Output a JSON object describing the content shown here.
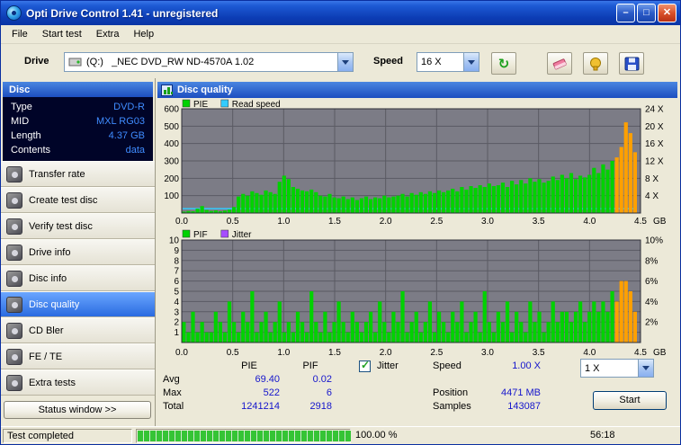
{
  "window": {
    "title": "Opti Drive Control 1.41 - unregistered"
  },
  "menu": {
    "items": [
      {
        "label": "File"
      },
      {
        "label": "Start test"
      },
      {
        "label": "Extra"
      },
      {
        "label": "Help"
      }
    ]
  },
  "toolbar": {
    "drive_label": "Drive",
    "drive_value": "(Q:)   _NEC DVD_RW ND-4570A 1.02",
    "speed_label": "Speed",
    "speed_value": "16 X"
  },
  "sidebar": {
    "header": "Disc",
    "info": [
      {
        "label": "Type",
        "value": "DVD-R"
      },
      {
        "label": "MID",
        "value": "MXL RG03"
      },
      {
        "label": "Length",
        "value": "4.37 GB"
      },
      {
        "label": "Contents",
        "value": "data"
      }
    ],
    "nav": [
      {
        "label": "Transfer rate",
        "selected": false
      },
      {
        "label": "Create test disc",
        "selected": false
      },
      {
        "label": "Verify test disc",
        "selected": false
      },
      {
        "label": "Drive info",
        "selected": false
      },
      {
        "label": "Disc info",
        "selected": false
      },
      {
        "label": "Disc quality",
        "selected": true
      },
      {
        "label": "CD Bler",
        "selected": false
      },
      {
        "label": "FE / TE",
        "selected": false
      },
      {
        "label": "Extra tests",
        "selected": false
      }
    ],
    "status_window_button": "Status window >>"
  },
  "main": {
    "header": "Disc quality",
    "stats": {
      "col_pie": "PIE",
      "col_pif": "PIF",
      "rows": [
        {
          "label": "Avg",
          "pie": "69.40",
          "pif": "0.02"
        },
        {
          "label": "Max",
          "pie": "522",
          "pif": "6"
        },
        {
          "label": "Total",
          "pie": "1241214",
          "pif": "2918"
        }
      ],
      "jitter_label": "Jitter",
      "jitter_checked": true,
      "speed_label": "Speed",
      "speed_value": "1.00 X",
      "position_label": "Position",
      "position_value": "4471 MB",
      "samples_label": "Samples",
      "samples_value": "143087",
      "speed_select": "1 X",
      "start_button": "Start"
    }
  },
  "statusbar": {
    "status": "Test completed",
    "progress_percent": 100,
    "percent_text": "100.00 %",
    "time": "56:18"
  },
  "chart_data": [
    {
      "type": "bar",
      "title": "PIE and read speed vs disc position",
      "legend": [
        {
          "label": "PIE",
          "color": "#00d200"
        },
        {
          "label": "Read speed",
          "color": "#33ccff"
        }
      ],
      "xlim": [
        0,
        4.5
      ],
      "ylim_left": [
        0,
        600
      ],
      "yticks_left": [
        {
          "v": 600,
          "label": "600"
        },
        {
          "v": 500,
          "label": "500"
        },
        {
          "v": 400,
          "label": "400"
        },
        {
          "v": 300,
          "label": "300"
        },
        {
          "v": 200,
          "label": "200"
        },
        {
          "v": 100,
          "label": "100"
        }
      ],
      "yticks_right": [
        {
          "v": 600,
          "label": "24 X"
        },
        {
          "v": 500,
          "label": "20 X"
        },
        {
          "v": 400,
          "label": "16 X"
        },
        {
          "v": 300,
          "label": "12 X"
        },
        {
          "v": 200,
          "label": "8 X"
        },
        {
          "v": 100,
          "label": "4 X"
        }
      ],
      "xticks": [
        {
          "v": 0,
          "label": "0.0"
        },
        {
          "v": 0.5,
          "label": "0.5"
        },
        {
          "v": 1,
          "label": "1.0"
        },
        {
          "v": 1.5,
          "label": "1.5"
        },
        {
          "v": 2,
          "label": "2.0"
        },
        {
          "v": 2.5,
          "label": "2.5"
        },
        {
          "v": 3,
          "label": "3.0"
        },
        {
          "v": 3.5,
          "label": "3.5"
        },
        {
          "v": 4,
          "label": "4.0"
        },
        {
          "v": 4.5,
          "label": "4.5"
        }
      ],
      "x_unit": "GB",
      "plot_bg": "#7c7c86",
      "grid_color": "#5a5a63",
      "border_color": "#2e2e38",
      "bar_color": "#00d200",
      "bar_color_high": "#ffa000",
      "high_from_x": 4.26,
      "x_start": 0.02,
      "x_step": 0.0447,
      "values": [
        8,
        12,
        10,
        25,
        40,
        18,
        12,
        15,
        10,
        14,
        20,
        35,
        95,
        110,
        100,
        125,
        115,
        105,
        130,
        120,
        110,
        180,
        215,
        195,
        150,
        140,
        130,
        125,
        135,
        120,
        100,
        95,
        110,
        90,
        85,
        95,
        80,
        90,
        75,
        85,
        95,
        80,
        90,
        85,
        100,
        90,
        95,
        100,
        110,
        95,
        115,
        105,
        120,
        110,
        125,
        115,
        130,
        120,
        130,
        140,
        125,
        150,
        135,
        155,
        145,
        160,
        150,
        170,
        155,
        160,
        175,
        150,
        185,
        165,
        190,
        170,
        200,
        180,
        195,
        175,
        185,
        210,
        190,
        220,
        200,
        230,
        195,
        215,
        205,
        220,
        260,
        230,
        280,
        250,
        300,
        320,
        380,
        522,
        460,
        350
      ],
      "line_series": {
        "label": "Read speed",
        "color": "#33ccff",
        "value": 25
      }
    },
    {
      "type": "bar",
      "title": "PIF and jitter vs disc position",
      "legend": [
        {
          "label": "PIF",
          "color": "#00d200"
        },
        {
          "label": "Jitter",
          "color": "#a64dff"
        }
      ],
      "xlim": [
        0,
        4.5
      ],
      "ylim_left": [
        0,
        10
      ],
      "yticks_left": [
        {
          "v": 10,
          "label": "10"
        },
        {
          "v": 9,
          "label": "9"
        },
        {
          "v": 8,
          "label": "8"
        },
        {
          "v": 7,
          "label": "7"
        },
        {
          "v": 6,
          "label": "6"
        },
        {
          "v": 5,
          "label": "5"
        },
        {
          "v": 4,
          "label": "4"
        },
        {
          "v": 3,
          "label": "3"
        },
        {
          "v": 2,
          "label": "2"
        },
        {
          "v": 1,
          "label": "1"
        }
      ],
      "yticks_right": [
        {
          "v": 10,
          "label": "10%"
        },
        {
          "v": 8,
          "label": "8%"
        },
        {
          "v": 6,
          "label": "6%"
        },
        {
          "v": 4,
          "label": "4%"
        },
        {
          "v": 2,
          "label": "2%"
        }
      ],
      "xticks": [
        {
          "v": 0,
          "label": "0.0"
        },
        {
          "v": 0.5,
          "label": "0.5"
        },
        {
          "v": 1,
          "label": "1.0"
        },
        {
          "v": 1.5,
          "label": "1.5"
        },
        {
          "v": 2,
          "label": "2.0"
        },
        {
          "v": 2.5,
          "label": "2.5"
        },
        {
          "v": 3,
          "label": "3.0"
        },
        {
          "v": 3.5,
          "label": "3.5"
        },
        {
          "v": 4,
          "label": "4.0"
        },
        {
          "v": 4.5,
          "label": "4.5"
        }
      ],
      "x_unit": "GB",
      "plot_bg": "#7c7c86",
      "grid_color": "#5a5a63",
      "border_color": "#2e2e38",
      "bar_color": "#00d200",
      "bar_color_high": "#ffa000",
      "high_from_x": 4.26,
      "x_start": 0.02,
      "x_step": 0.0447,
      "values": [
        2,
        1,
        3,
        1,
        2,
        1,
        1,
        3,
        2,
        1,
        4,
        2,
        1,
        3,
        2,
        5,
        1,
        2,
        3,
        1,
        2,
        4,
        1,
        2,
        1,
        3,
        2,
        1,
        5,
        2,
        1,
        3,
        1,
        2,
        4,
        2,
        1,
        3,
        2,
        1,
        2,
        3,
        1,
        4,
        2,
        1,
        3,
        2,
        5,
        1,
        2,
        3,
        1,
        2,
        4,
        1,
        3,
        2,
        1,
        3,
        2,
        4,
        1,
        2,
        3,
        1,
        5,
        2,
        1,
        3,
        2,
        4,
        1,
        3,
        2,
        1,
        4,
        2,
        3,
        1,
        2,
        4,
        2,
        3,
        3,
        2,
        3,
        4,
        2,
        3,
        4,
        3,
        4,
        3,
        5,
        4,
        6,
        6,
        5,
        3
      ]
    }
  ]
}
